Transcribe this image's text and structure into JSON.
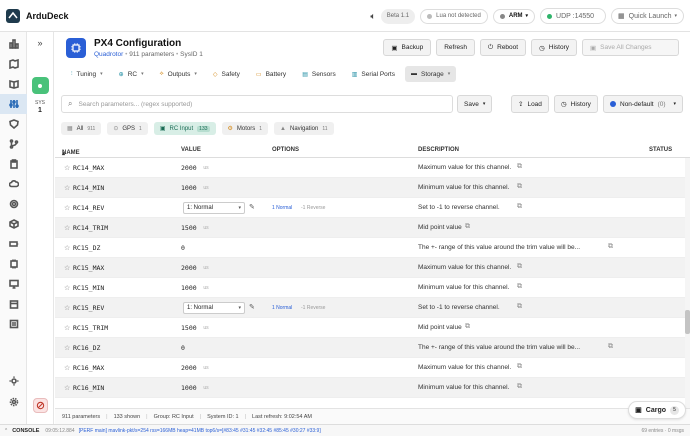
{
  "app": {
    "name": "ArduDeck"
  },
  "topbar": {
    "beta": "Beta 1.1",
    "lua": "Lua not detected",
    "arm": "ARM",
    "udp": "UDP :14550",
    "quick_launch": "Quick Launch"
  },
  "system": {
    "label": "SYS",
    "id": "1"
  },
  "header": {
    "title": "PX4 Configuration",
    "vehicle": "Quadrotor",
    "params": "911 parameters",
    "sysid": "SysID 1"
  },
  "actions": [
    "Backup",
    "Refresh",
    "Reboot",
    "History",
    "Save All Changes"
  ],
  "tabs": [
    "Tuning",
    "RC",
    "Outputs",
    "Safety",
    "Battery",
    "Sensors",
    "Serial Ports",
    "Storage"
  ],
  "search": {
    "placeholder": "Search parameters... (regex supported)",
    "save": "Save",
    "load": "Load",
    "history": "History",
    "filter": "Non-default",
    "filter_count": "(0)"
  },
  "chips": [
    {
      "label": "All",
      "count": "911"
    },
    {
      "label": "GPS",
      "count": "1"
    },
    {
      "label": "RC Input",
      "count": "133"
    },
    {
      "label": "Motors",
      "count": "1"
    },
    {
      "label": "Navigation",
      "count": "11"
    }
  ],
  "columns": [
    "NAME",
    "VALUE",
    "OPTIONS",
    "DESCRIPTION",
    "STATUS"
  ],
  "rows": [
    {
      "name": "RC14_MAX",
      "value": "2000",
      "unit": "us",
      "desc": "Maximum value for this channel."
    },
    {
      "name": "RC14_MIN",
      "value": "1000",
      "unit": "us",
      "desc": "Minimum value for this channel."
    },
    {
      "name": "RC14_REV",
      "select": "1: Normal",
      "opt1": "1 Normal",
      "opt2": "-1 Reverse",
      "desc": "Set to -1 to reverse channel."
    },
    {
      "name": "RC14_TRIM",
      "value": "1500",
      "unit": "us",
      "desc": "Mid point value"
    },
    {
      "name": "RC15_DZ",
      "value": "0",
      "unit": "",
      "desc": "The +- range of this value around the trim value will be..."
    },
    {
      "name": "RC15_MAX",
      "value": "2000",
      "unit": "us",
      "desc": "Maximum value for this channel."
    },
    {
      "name": "RC15_MIN",
      "value": "1000",
      "unit": "us",
      "desc": "Minimum value for this channel."
    },
    {
      "name": "RC15_REV",
      "select": "1: Normal",
      "opt1": "1 Normal",
      "opt2": "-1 Reverse",
      "desc": "Set to -1 to reverse channel."
    },
    {
      "name": "RC15_TRIM",
      "value": "1500",
      "unit": "us",
      "desc": "Mid point value"
    },
    {
      "name": "RC16_DZ",
      "value": "0",
      "unit": "",
      "desc": "The +- range of this value around the trim value will be..."
    },
    {
      "name": "RC16_MAX",
      "value": "2000",
      "unit": "us",
      "desc": "Maximum value for this channel."
    },
    {
      "name": "RC16_MIN",
      "value": "1000",
      "unit": "us",
      "desc": "Minimum value for this channel."
    }
  ],
  "footer": {
    "params": "911 parameters",
    "shown": "133 shown",
    "group": "Group: RC Input",
    "sysid": "System ID: 1",
    "refresh": "Last refresh: 9:02:54 AM"
  },
  "cargo": {
    "label": "Cargo",
    "count": "5"
  },
  "console": {
    "title": "CONSOLE",
    "time": "09:05:12.884",
    "message": "[PERF main] mavlink-pkt/s=254 rss=166MB heap=41MB top6/s=[#83:45 #31:45 #32:45 #85:45 #30:27 #33:9]",
    "entries": "69 entries · 0 msgs"
  }
}
